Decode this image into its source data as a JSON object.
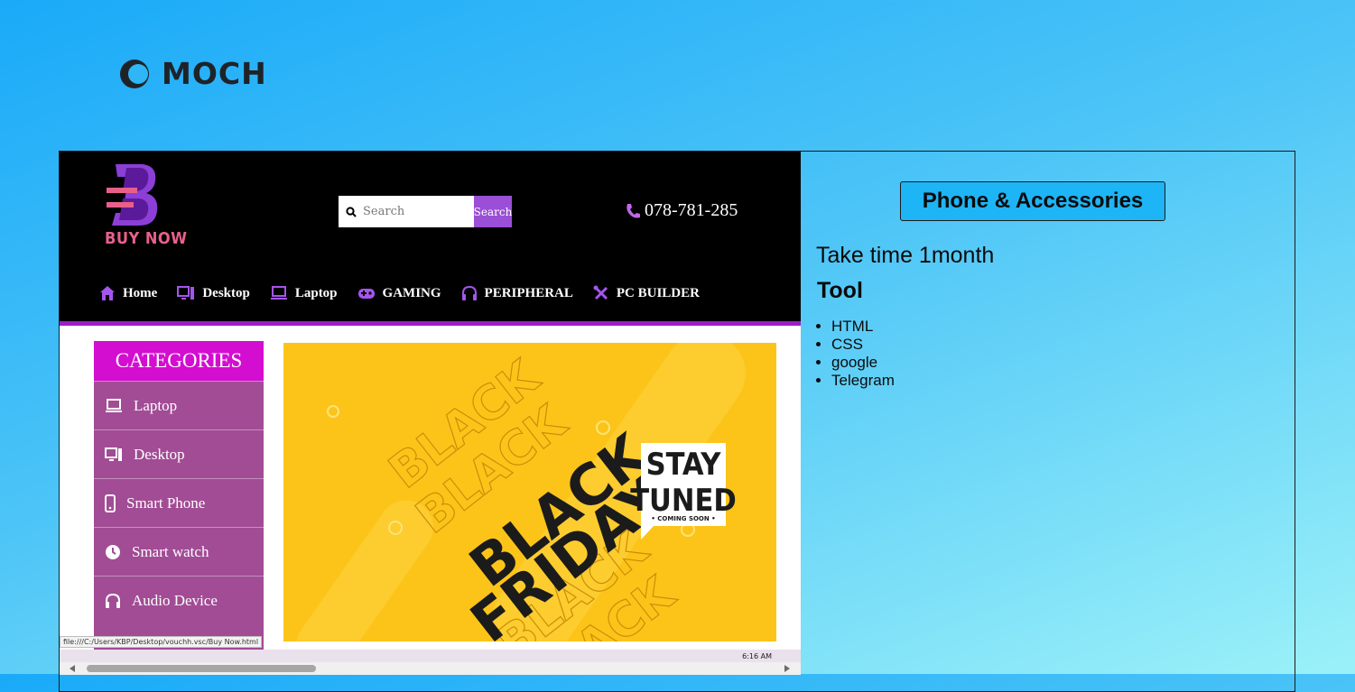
{
  "brand": {
    "name": "MOCH",
    "icon": "crescent-moon-icon"
  },
  "preview": {
    "logo_text": "BUY NOW",
    "search": {
      "placeholder": "Search",
      "button": "Search"
    },
    "phone": "078-781-285",
    "nav": [
      {
        "label": "Home",
        "icon": "home-icon"
      },
      {
        "label": "Desktop",
        "icon": "desktop-icon"
      },
      {
        "label": "Laptop",
        "icon": "laptop-icon"
      },
      {
        "label": "GAMING",
        "icon": "gamepad-icon"
      },
      {
        "label": "PERIPHERAL",
        "icon": "headphones-icon"
      },
      {
        "label": "PC BUILDER",
        "icon": "tools-icon"
      }
    ],
    "categories": {
      "title": "CATEGORIES",
      "items": [
        {
          "label": "Laptop",
          "icon": "laptop-icon"
        },
        {
          "label": "Desktop",
          "icon": "desktop-icon"
        },
        {
          "label": "Smart Phone",
          "icon": "phone-icon"
        },
        {
          "label": "Smart watch",
          "icon": "clock-icon"
        },
        {
          "label": "Audio Device",
          "icon": "headphones-icon"
        }
      ]
    },
    "banner": {
      "bg_word": "BLACK",
      "title_line1": "BLACK",
      "title_line2": "FRIDAY",
      "card_line1": "STAY",
      "card_line2": "TUNED",
      "card_sub": "• COMING SOON •"
    },
    "status_url": "file:///C:/Users/KBP/Desktop/vouchh.vsc/Buy Now.html",
    "clock": "6:16 AM"
  },
  "project": {
    "title": "Phone & Accessories",
    "duration": "Take time 1month",
    "tools_heading": "Tool",
    "tools": [
      "HTML",
      "CSS",
      "google",
      "Telegram"
    ]
  },
  "colors": {
    "accent": "#1db5f5",
    "header_bg": "#000000",
    "banner_bg": "#fcc419",
    "category_bg": "#a24c95",
    "nav_accent": "#9b4fd6"
  }
}
